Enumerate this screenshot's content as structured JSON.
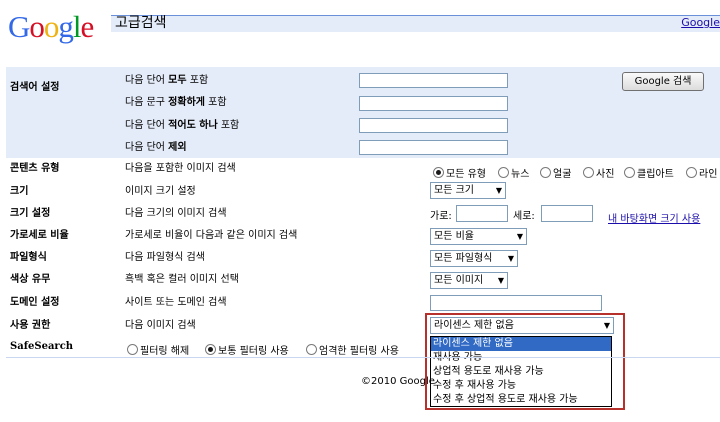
{
  "logo": {
    "letters": [
      "G",
      "o",
      "o",
      "g",
      "l",
      "e"
    ],
    "colors": [
      "#3369e8",
      "#d50f25",
      "#eeb211",
      "#3369e8",
      "#009925",
      "#d50f25"
    ]
  },
  "header": {
    "title": "고급검색",
    "help_link": "Google"
  },
  "find": {
    "section_label": "검색어 설정",
    "rows": [
      {
        "pre": "다음 단어 ",
        "bold": "모두",
        "post": " 포함"
      },
      {
        "pre": "다음 문구 ",
        "bold": "정확하게",
        "post": " 포함"
      },
      {
        "pre": "다음 단어 ",
        "bold": "적어도 하나",
        "post": " 포함"
      },
      {
        "pre": "다음 단어 ",
        "bold": "제외",
        "post": ""
      }
    ],
    "search_button": "Google 검색"
  },
  "content_type": {
    "label": "콘텐츠 유형",
    "desc": "다음을 포함한 이미지 검색",
    "options": [
      "모든 유형",
      "뉴스",
      "얼굴",
      "사진",
      "클립아트",
      "라인"
    ],
    "selected": 0
  },
  "size": {
    "label": "크기",
    "desc": "이미지 크기 설정",
    "value": "모든 크기"
  },
  "exact_size": {
    "label": "크기 설정",
    "desc": "다음 크기의 이미지 검색",
    "width_label": "가로:",
    "height_label": "세로:",
    "link": "내 바탕화면 크기 사용"
  },
  "aspect": {
    "label": "가로세로 비율",
    "desc": "가로세로 비율이 다음과 같은 이미지 검색",
    "value": "모든 비율"
  },
  "filetype": {
    "label": "파일형식",
    "desc": "다음 파일형식 검색",
    "value": "모든 파일형식"
  },
  "color": {
    "label": "색상 유무",
    "desc": "흑백 혹은 컬러 이미지 선택",
    "value": "모든 이미지"
  },
  "domain": {
    "label": "도메인 설정",
    "desc": "사이트 또는 도메인 검색"
  },
  "usage": {
    "label": "사용 권한",
    "desc": "다음 이미지 검색",
    "value": "라이센스 제한 없음",
    "options": [
      "라이센스 제한 없음",
      "재사용 가능",
      "상업적 용도로 재사용 가능",
      "수정 후 재사용 가능",
      "수정 후 상업적 용도로 재사용 가능"
    ],
    "highlighted": 0
  },
  "safesearch": {
    "label": "SafeSearch",
    "options": [
      "필터링 해제",
      "보통 필터링 사용",
      "엄격한 필터링 사용"
    ],
    "selected": 1
  },
  "footer": {
    "copyright": "©2010 Google"
  }
}
